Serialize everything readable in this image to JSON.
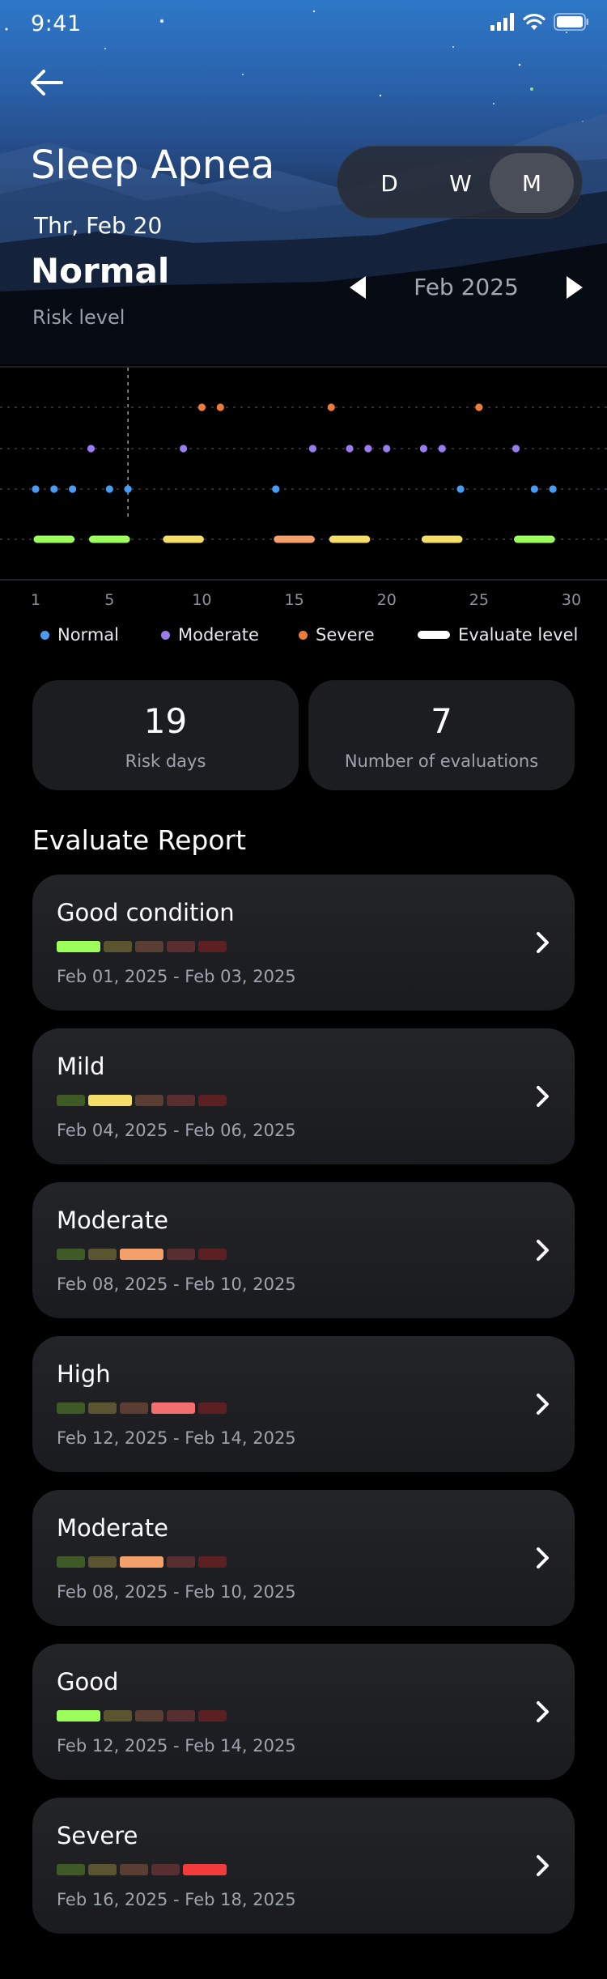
{
  "status_bar": {
    "time": "9:41"
  },
  "header": {
    "title": "Sleep Apnea",
    "date": "Thr, Feb 20",
    "risk_value": "Normal",
    "risk_label": "Risk level",
    "segments": [
      "D",
      "W",
      "M"
    ],
    "active_segment": "M",
    "month": "Feb 2025"
  },
  "colors": {
    "normal": "#4a9cf2",
    "moderate": "#9b7bf0",
    "severe": "#f07a38",
    "good": "#9dff5c",
    "mild": "#f5dd6a",
    "moderate_level": "#f4a06a",
    "high": "#f36f6f",
    "severe_level": "#f23b3b"
  },
  "chart_data": {
    "type": "scatter",
    "x_ticks": [
      "1",
      "5",
      "10",
      "15",
      "20",
      "25",
      "30"
    ],
    "xlim": [
      1,
      30
    ],
    "y_levels": [
      "Severe",
      "Moderate",
      "Normal",
      "Evaluate level"
    ],
    "selected_day": 6,
    "series": [
      {
        "name": "Normal",
        "x": [
          1,
          2,
          3,
          5,
          6,
          14,
          24,
          28,
          29
        ]
      },
      {
        "name": "Moderate",
        "x": [
          4,
          9,
          16,
          18,
          19,
          20,
          22,
          23,
          27
        ]
      },
      {
        "name": "Severe",
        "x": [
          10,
          11,
          17,
          25
        ]
      }
    ],
    "evaluations": [
      {
        "start": 1,
        "end": 3,
        "level": "good"
      },
      {
        "start": 4,
        "end": 6,
        "level": "good"
      },
      {
        "start": 8,
        "end": 10,
        "level": "mild"
      },
      {
        "start": 14,
        "end": 16,
        "level": "moderate"
      },
      {
        "start": 17,
        "end": 19,
        "level": "mild"
      },
      {
        "start": 22,
        "end": 24,
        "level": "mild"
      },
      {
        "start": 27,
        "end": 29,
        "level": "good"
      }
    ]
  },
  "legend": [
    "Normal",
    "Moderate",
    "Severe",
    "Evaluate level"
  ],
  "stats": [
    {
      "value": "19",
      "label": "Risk days"
    },
    {
      "value": "7",
      "label": "Number of evaluations"
    }
  ],
  "section_title": "Evaluate Report",
  "reports": [
    {
      "title": "Good condition",
      "range": "Feb 01, 2025 - Feb 03, 2025",
      "level_index": 0
    },
    {
      "title": "Mild",
      "range": "Feb 04, 2025 - Feb 06, 2025",
      "level_index": 1
    },
    {
      "title": "Moderate",
      "range": "Feb 08, 2025 - Feb 10, 2025",
      "level_index": 2
    },
    {
      "title": "High",
      "range": "Feb 12, 2025 - Feb 14, 2025",
      "level_index": 3
    },
    {
      "title": "Moderate",
      "range": "Feb 08, 2025 - Feb 10, 2025",
      "level_index": 2
    },
    {
      "title": "Good",
      "range": "Feb 12, 2025 - Feb 14, 2025",
      "level_index": 0
    },
    {
      "title": "Severe",
      "range": "Feb 16, 2025 - Feb 18, 2025",
      "level_index": 4
    }
  ],
  "level_scale": {
    "active": [
      "#9dff5c",
      "#f5dd6a",
      "#f4a06a",
      "#f36f6f",
      "#f23b3b"
    ],
    "dim": [
      "#3f5a26",
      "#5a5430",
      "#5a3e33",
      "#582e31",
      "#5c2023"
    ]
  }
}
